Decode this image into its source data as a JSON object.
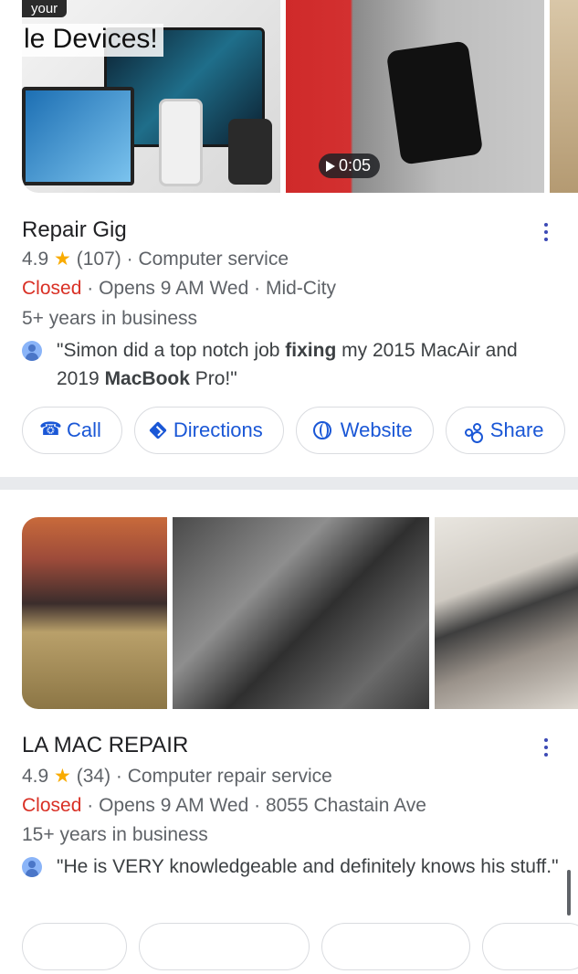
{
  "listings": [
    {
      "name": "Repair Gig",
      "rating": "4.9",
      "star": "★",
      "review_count": "(107)",
      "category": "Computer service",
      "status": "Closed",
      "hours": "Opens 9 AM Wed",
      "location": "Mid-City",
      "years": "5+ years in business",
      "review_parts": [
        "\"Simon did a top notch job ",
        "fixing",
        " my 2015 MacAir and 2019 ",
        "MacBook",
        " Pro!\""
      ],
      "photos": {
        "promo_pill": "your",
        "promo_text": "le Devices!",
        "video_duration": "0:05"
      },
      "actions": [
        "Call",
        "Directions",
        "Website",
        "Share"
      ]
    },
    {
      "name": "LA MAC REPAIR",
      "rating": "4.9",
      "star": "★",
      "review_count": "(34)",
      "category": "Computer repair service",
      "status": "Closed",
      "hours": "Opens 9 AM Wed",
      "location": "8055 Chastain Ave",
      "years": "15+ years in business",
      "review": "\"He is VERY knowledgeable and definitely knows his stuff.\""
    }
  ],
  "separator": "·",
  "colors": {
    "accent": "#1a57d6",
    "closed": "#d93025",
    "star": "#f9ab00",
    "divider": "#e8eaed"
  },
  "icons": [
    "call-icon",
    "directions-icon",
    "website-icon",
    "share-icon",
    "more-vert-icon",
    "user-avatar-icon",
    "play-icon"
  ]
}
